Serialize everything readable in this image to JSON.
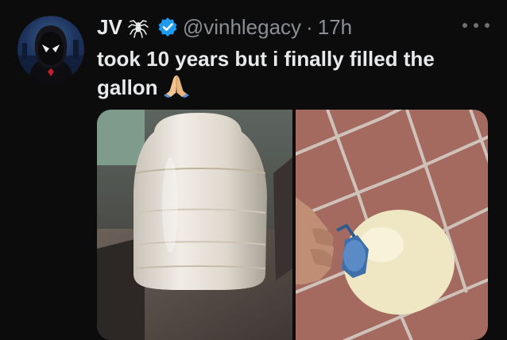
{
  "tweet": {
    "author_name": "JV",
    "handle": "@vinhlegacy",
    "separator": "·",
    "time": "17h",
    "text_line1": "took 10 years but i finally filled the",
    "text_line2": "gallon",
    "emoji": "🙏",
    "icons": {
      "name_decoration": "spider-icon",
      "verified": "verified-badge-icon",
      "more": "more-options-icon"
    },
    "colors": {
      "background": "#0c0c0d",
      "text": "#e7e9ea",
      "muted": "#8b8f94",
      "verified": "#1d9bf0"
    }
  },
  "media": {
    "count": 2,
    "images": [
      "gallon-jug-on-table-photo",
      "hand-holding-gallon-jug-photo"
    ]
  }
}
